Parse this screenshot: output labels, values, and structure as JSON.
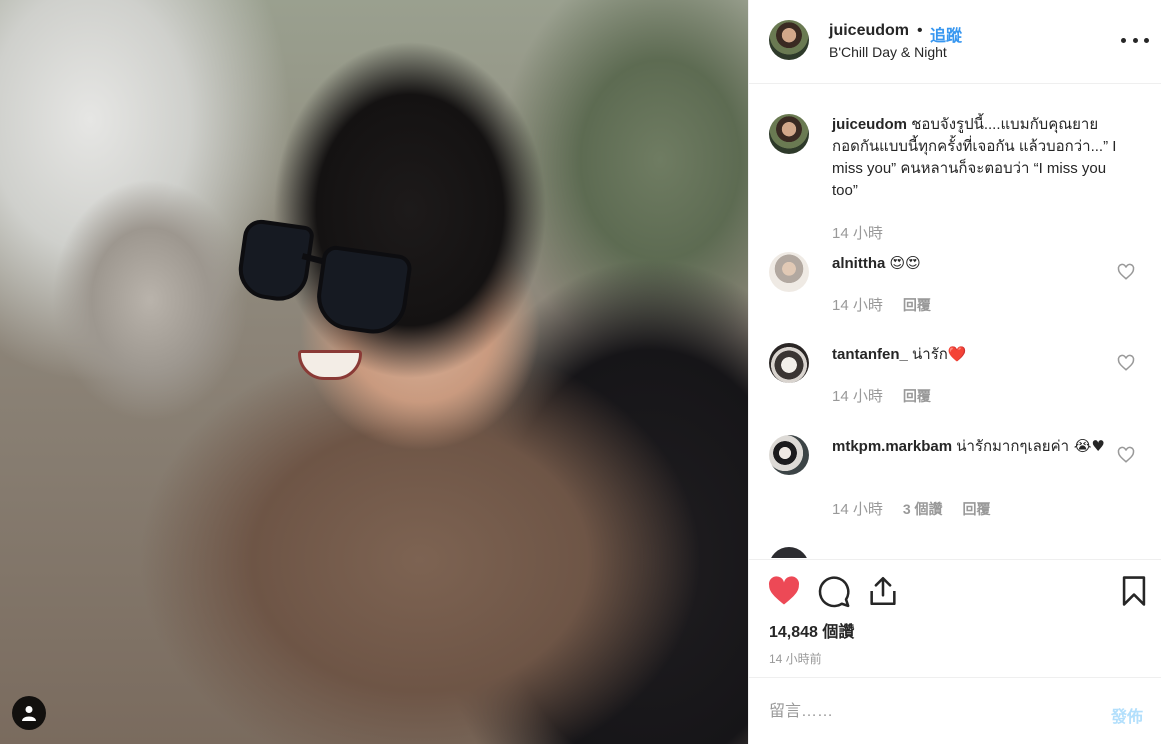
{
  "header": {
    "username": "juiceudom",
    "separator": "•",
    "follow_label": "追蹤",
    "location": "B'Chill Day & Night",
    "more_icon": "more-options-icon"
  },
  "caption": {
    "username": "juiceudom",
    "text": "ชอบจังรูปนี้....แบมกับคุณยาย กอดกันแบบนี้ทุกครั้งที่เจอกัน แล้วบอกว่า...” I miss you” คนหลานก็จะตอบว่า “I miss you too”",
    "time": "14 小時"
  },
  "comments": [
    {
      "username": "alnittha",
      "text": "😍😍",
      "time": "14 小時",
      "reply": "回覆"
    },
    {
      "username": "tantanfen_",
      "text": "น่ารัก❤️",
      "time": "14 小時",
      "reply": "回覆"
    },
    {
      "username": "mtkpm.markbam",
      "text": "น่ารักมากๆเลยค่า 😭♥",
      "time": "14 小時",
      "likes": "3 個讚",
      "reply": "回覆"
    }
  ],
  "actions": {
    "like_icon": "heart-filled-icon",
    "comment_icon": "comment-icon",
    "share_icon": "share-icon",
    "save_icon": "bookmark-icon",
    "like_color": "#ed4956"
  },
  "likes_count": "14,848 個讚",
  "posted_ago": "14 小時前",
  "comment_box": {
    "placeholder": "留言……",
    "post_label": "發佈"
  }
}
